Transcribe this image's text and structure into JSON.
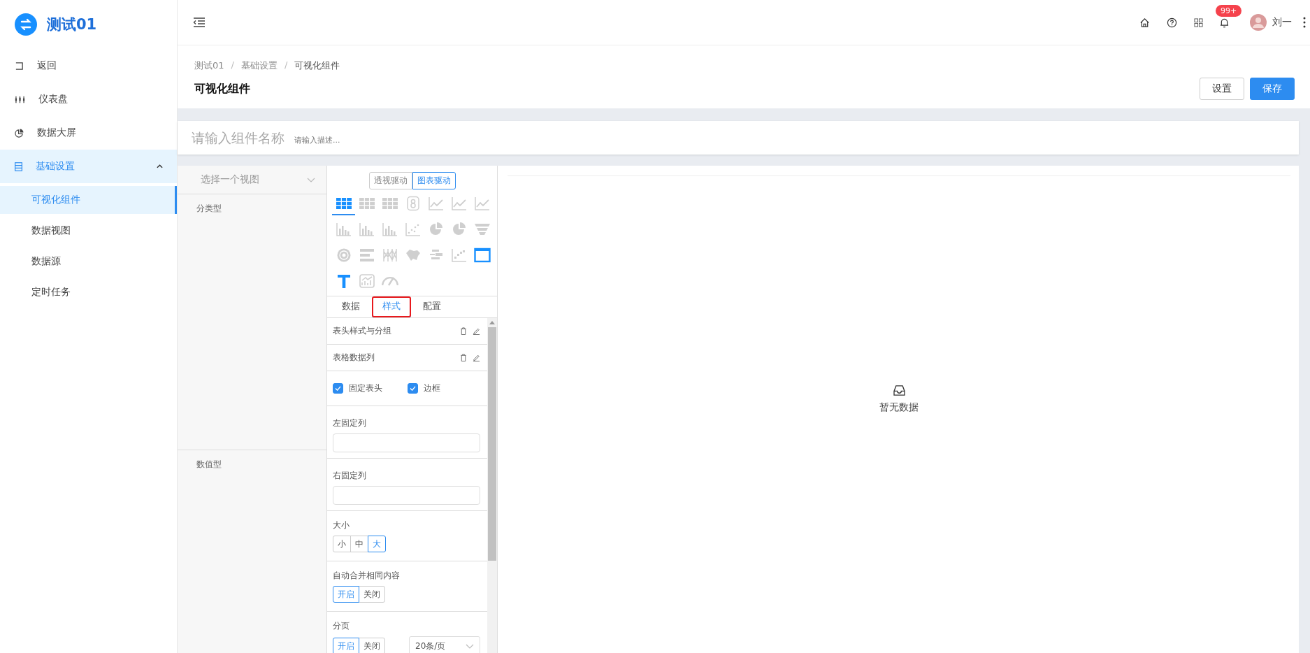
{
  "sidebar": {
    "logo": "测试01",
    "items": [
      {
        "label": "返回",
        "selected": false
      },
      {
        "label": "仪表盘",
        "selected": false
      },
      {
        "label": "数据大屏",
        "selected": false
      },
      {
        "label": "基础设置",
        "selected": true,
        "expanded": true,
        "children": [
          {
            "label": "可视化组件",
            "selected": true
          },
          {
            "label": "数据视图",
            "selected": false
          },
          {
            "label": "数据源",
            "selected": false
          },
          {
            "label": "定时任务",
            "selected": false
          }
        ]
      }
    ]
  },
  "header": {
    "badge": "99+",
    "user": "刘一"
  },
  "breadcrumb": [
    "测试01",
    "基础设置",
    "可视化组件"
  ],
  "breadcrumb_separator": "/",
  "page_title": "可视化组件",
  "buttons": [
    {
      "label": "设置",
      "kind": "default"
    },
    {
      "label": "保存",
      "kind": "primary"
    }
  ],
  "name_field": {
    "placeholder": "请输入组件名称"
  },
  "description_field": {
    "placeholder": "请输入描述..."
  },
  "view_select": {
    "placeholder": "选择一个视图"
  },
  "field_groups": [
    "分类型",
    "数值型"
  ],
  "mode_switch": [
    {
      "label": "透视驱动",
      "selected": false
    },
    {
      "label": "图表驱动",
      "selected": true
    }
  ],
  "chart_types": [
    {
      "kind": "table",
      "selected": true,
      "disabled": false
    },
    {
      "kind": "table",
      "selected": false,
      "disabled": true
    },
    {
      "kind": "table",
      "selected": false,
      "disabled": true
    },
    {
      "kind": "number",
      "selected": false,
      "disabled": true
    },
    {
      "kind": "line",
      "selected": false,
      "disabled": true
    },
    {
      "kind": "line",
      "selected": false,
      "disabled": true
    },
    {
      "kind": "line",
      "selected": false,
      "disabled": true
    },
    {
      "kind": "bar",
      "selected": false,
      "disabled": true
    },
    {
      "kind": "bar",
      "selected": false,
      "disabled": true
    },
    {
      "kind": "bar",
      "selected": false,
      "disabled": true
    },
    {
      "kind": "scatter",
      "selected": false,
      "disabled": true
    },
    {
      "kind": "pie",
      "selected": false,
      "disabled": true
    },
    {
      "kind": "pie",
      "selected": false,
      "disabled": true
    },
    {
      "kind": "funnel",
      "selected": false,
      "disabled": true
    },
    {
      "kind": "radar",
      "selected": false,
      "disabled": true
    },
    {
      "kind": "hbar",
      "selected": false,
      "disabled": true
    },
    {
      "kind": "parallel",
      "selected": false,
      "disabled": true
    },
    {
      "kind": "map",
      "selected": false,
      "disabled": true
    },
    {
      "kind": "cloud",
      "selected": false,
      "disabled": true
    },
    {
      "kind": "step",
      "selected": false,
      "disabled": true
    },
    {
      "kind": "frame",
      "selected": false,
      "disabled": false
    },
    {
      "kind": "text",
      "selected": false,
      "disabled": false
    },
    {
      "kind": "image",
      "selected": false,
      "disabled": true
    },
    {
      "kind": "gauge",
      "selected": false,
      "disabled": true
    }
  ],
  "tabs": [
    {
      "label": "数据",
      "selected": false,
      "highlighted": false
    },
    {
      "label": "样式",
      "selected": true,
      "highlighted": true
    },
    {
      "label": "配置",
      "selected": false,
      "highlighted": false
    }
  ],
  "style_sections": [
    {
      "kind": "actions",
      "label": "表头样式与分组"
    },
    {
      "kind": "actions",
      "label": "表格数据列"
    },
    {
      "kind": "checkboxes",
      "options": [
        {
          "label": "固定表头",
          "checked": true
        },
        {
          "label": "边框",
          "checked": true
        }
      ]
    },
    {
      "kind": "input",
      "label": "左固定列"
    },
    {
      "kind": "input",
      "label": "右固定列"
    },
    {
      "kind": "segmented",
      "label": "大小",
      "options": [
        {
          "label": "小",
          "selected": false
        },
        {
          "label": "中",
          "selected": false
        },
        {
          "label": "大",
          "selected": true
        }
      ]
    },
    {
      "kind": "segmented",
      "label": "自动合并相同内容",
      "options": [
        {
          "label": "开启",
          "selected": true
        },
        {
          "label": "关闭",
          "selected": false
        }
      ]
    },
    {
      "kind": "segmented",
      "label": "分页",
      "options": [
        {
          "label": "开启",
          "selected": true
        },
        {
          "label": "关闭",
          "selected": false
        }
      ],
      "select": {
        "value": "20条/页"
      }
    }
  ],
  "preview": {
    "empty_text": "暂无数据"
  }
}
